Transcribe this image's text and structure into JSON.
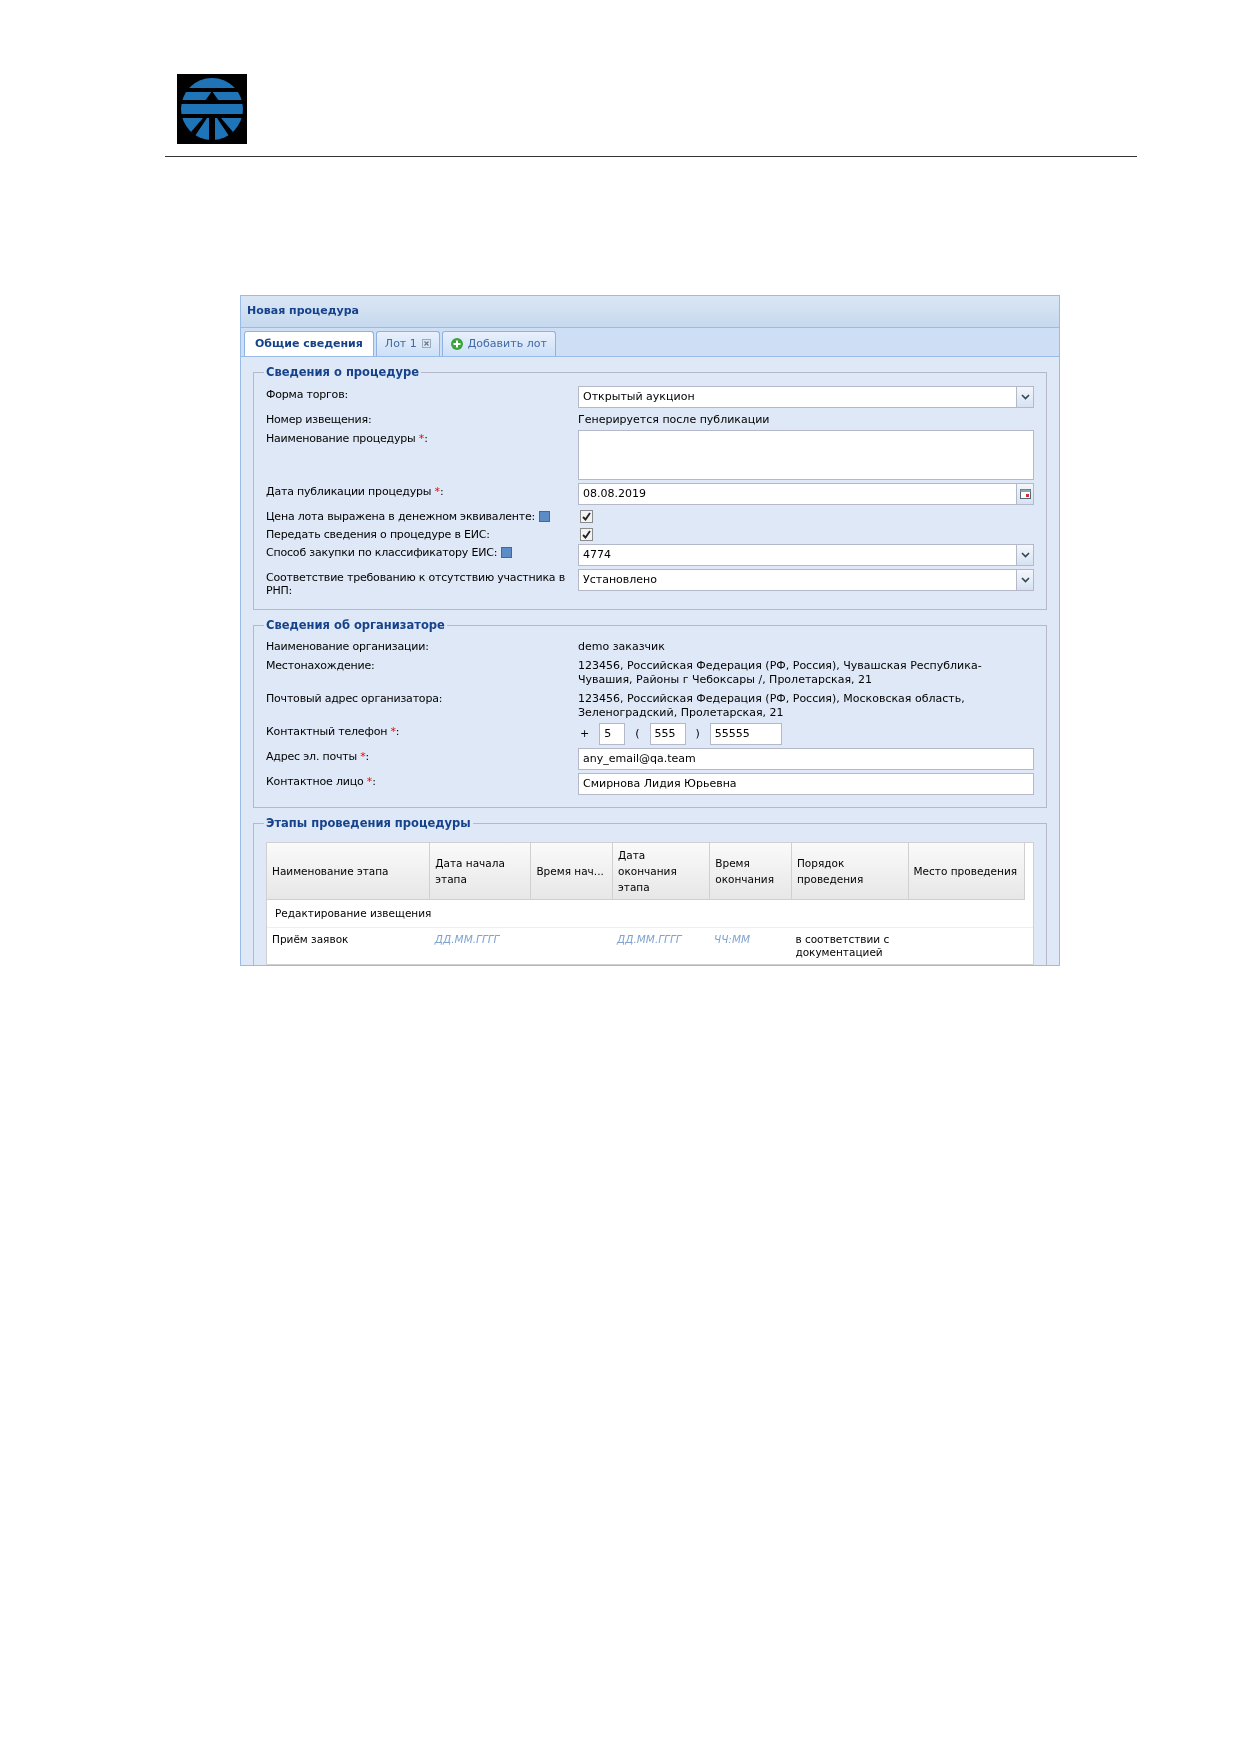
{
  "window": {
    "title": "Новая процедура"
  },
  "tabs": [
    {
      "label": "Общие сведения",
      "selected": true,
      "kind": "plain"
    },
    {
      "label": "Лот 1",
      "selected": false,
      "kind": "closable"
    },
    {
      "label": "Добавить лот",
      "selected": false,
      "kind": "add"
    }
  ],
  "sections": [
    {
      "legend": "Сведения о процедуре",
      "fields": [
        {
          "label": "Форма торгов:",
          "kind": "select",
          "value": "Открытый аукцион"
        },
        {
          "label": "Номер извещения:",
          "kind": "static",
          "value": "Генерируется после публикации"
        },
        {
          "label": "Наименование процедуры",
          "required_mark": "*",
          "label_tail": ":",
          "kind": "textarea"
        },
        {
          "label": "Дата публикации процедуры",
          "required_mark": "*",
          "label_tail": ":",
          "kind": "date",
          "value": "08.08.2019"
        },
        {
          "label": "Цена лота выражена в денежном эквиваленте:",
          "help": true,
          "kind": "checkbox",
          "checked": true
        },
        {
          "label": "Передать сведения о процедуре в ЕИС:",
          "kind": "checkbox",
          "checked": true
        },
        {
          "label": "Способ закупки по классификатору ЕИС:",
          "help": true,
          "kind": "select",
          "value": "4774"
        },
        {
          "label": "Соответствие требованию к отсутствию участника в РНП:",
          "kind": "select",
          "value": "Установлено"
        }
      ]
    },
    {
      "legend": "Сведения об организаторе",
      "fields": [
        {
          "label": "Наименование организации:",
          "kind": "static",
          "value": "demo заказчик"
        },
        {
          "label": "Местонахождение:",
          "kind": "static",
          "value": "123456, Российская Федерация (РФ, Россия), Чувашская Республика-Чувашия, Районы г Чебоксары /, Пролетарская, 21"
        },
        {
          "label": "Почтовый адрес организатора:",
          "kind": "static",
          "value": "123456, Российская Федерация (РФ, Россия), Московская область, Зеленоградский, Пролетарская, 21"
        },
        {
          "label": "Контактный телефон",
          "required_mark": "*",
          "label_tail": ":",
          "kind": "phone",
          "parts": [
            {
              "sign": "+",
              "value": "5"
            },
            {
              "sign": "(",
              "value": "555"
            },
            {
              "sign": ")",
              "value": "55555"
            }
          ]
        },
        {
          "label": "Адрес эл. почты",
          "required_mark": "*",
          "label_tail": ":",
          "kind": "text",
          "value": "any_email@qa.team"
        },
        {
          "label": "Контактное лицо",
          "required_mark": "*",
          "label_tail": ":",
          "kind": "text",
          "value": "Смирнова Лидия Юрьевна"
        }
      ]
    }
  ],
  "stages": {
    "legend": "Этапы проведения процедуры",
    "columns": [
      "Наименование этапа",
      "Дата начала этапа",
      "Время нач...",
      "Дата окончания этапа",
      "Время окончания",
      "Порядок проведения",
      "Место проведения"
    ],
    "rows": [
      {
        "kind": "group",
        "title": "Редактирование извещения"
      },
      {
        "kind": "row",
        "cells": [
          {
            "text": "Приём заявок",
            "kind": "text"
          },
          {
            "text": "ДД.ММ.ГГГГ",
            "kind": "hint"
          },
          null,
          {
            "text": "ДД.ММ.ГГГГ",
            "kind": "hint"
          },
          {
            "text": "ЧЧ:ММ",
            "kind": "hint"
          },
          {
            "text": "в соответствии с документацией",
            "kind": "text"
          },
          null
        ]
      }
    ]
  }
}
